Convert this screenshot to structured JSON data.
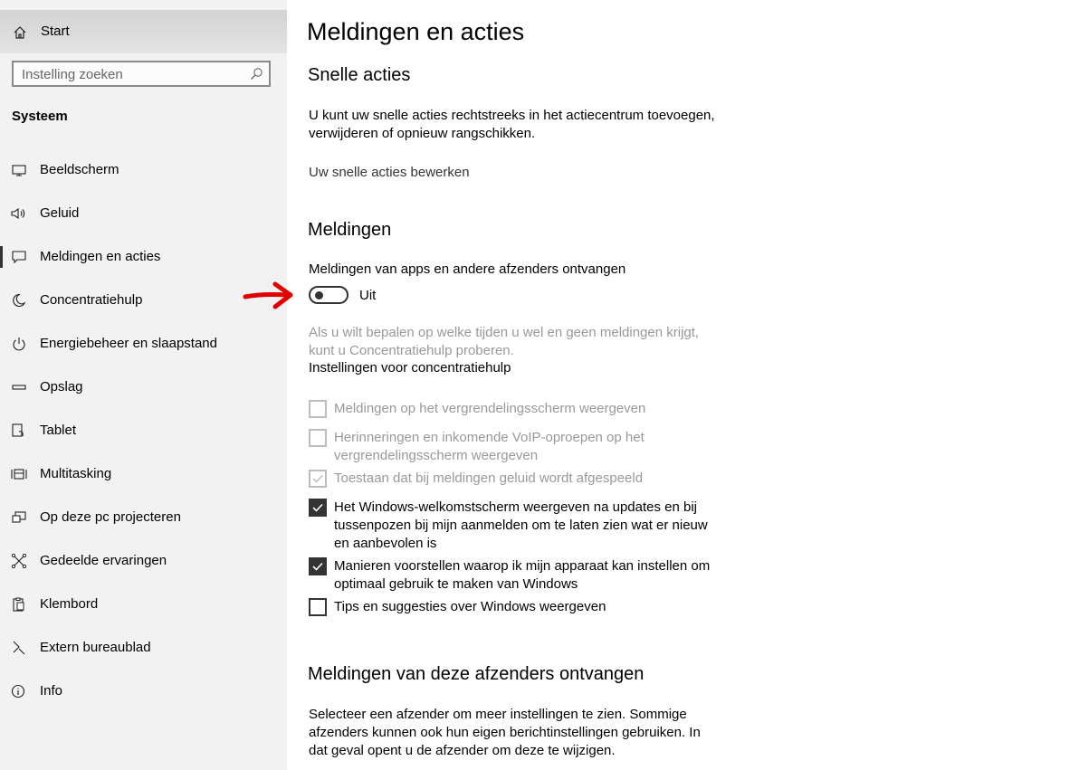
{
  "sidebar": {
    "start_label": "Start",
    "search_placeholder": "Instelling zoeken",
    "section_title": "Systeem",
    "items": [
      {
        "label": "Beeldscherm",
        "icon": "monitor-icon"
      },
      {
        "label": "Geluid",
        "icon": "speaker-icon"
      },
      {
        "label": "Meldingen en acties",
        "icon": "message-icon",
        "active": true
      },
      {
        "label": "Concentratiehulp",
        "icon": "moon-icon"
      },
      {
        "label": "Energiebeheer en slaapstand",
        "icon": "power-icon"
      },
      {
        "label": "Opslag",
        "icon": "storage-icon"
      },
      {
        "label": "Tablet",
        "icon": "tablet-icon"
      },
      {
        "label": "Multitasking",
        "icon": "multitasking-icon"
      },
      {
        "label": "Op deze pc projecteren",
        "icon": "project-icon"
      },
      {
        "label": "Gedeelde ervaringen",
        "icon": "shared-icon"
      },
      {
        "label": "Klembord",
        "icon": "clipboard-icon"
      },
      {
        "label": "Extern bureaublad",
        "icon": "remote-desktop-icon"
      },
      {
        "label": "Info",
        "icon": "info-icon"
      }
    ]
  },
  "main": {
    "title": "Meldingen en acties",
    "quick_actions": {
      "heading": "Snelle acties",
      "description": "U kunt uw snelle acties rechtstreeks in het actiecentrum toevoegen, verwijderen of opnieuw rangschikken.",
      "edit_link": "Uw snelle acties bewerken"
    },
    "notifications": {
      "heading": "Meldingen",
      "toggle_caption": "Meldingen van apps en andere afzenders ontvangen",
      "toggle_state_label": "Uit",
      "toggle_on": false,
      "focus_hint": "Als u wilt bepalen op welke tijden u wel en geen meldingen krijgt, kunt u Concentratiehulp proberen.",
      "focus_link": "Instellingen voor concentratiehulp",
      "checkboxes": [
        {
          "label": "Meldingen op het vergrendelingsscherm weergeven",
          "checked": false,
          "enabled": false
        },
        {
          "label": "Herinneringen en inkomende VoIP-oproepen op het vergrendelingsscherm weergeven",
          "checked": false,
          "enabled": false
        },
        {
          "label": "Toestaan dat bij meldingen geluid wordt afgespeeld",
          "checked": true,
          "enabled": false
        },
        {
          "label": "Het Windows-welkomstscherm weergeven na updates en bij tussenpozen bij mijn aanmelden om te laten zien wat er nieuw en aanbevolen is",
          "checked": true,
          "enabled": true
        },
        {
          "label": "Manieren voorstellen waarop ik mijn apparaat kan instellen om optimaal gebruik te maken van Windows",
          "checked": true,
          "enabled": true
        },
        {
          "label": "Tips en suggesties over Windows weergeven",
          "checked": false,
          "enabled": true
        }
      ]
    },
    "senders": {
      "heading": "Meldingen van deze afzenders ontvangen",
      "description": "Selecteer een afzender om meer instellingen te zien. Sommige afzenders kunnen ook hun eigen berichtinstellingen gebruiken. In dat geval opent u de afzender om deze te wijzigen."
    }
  },
  "colors": {
    "sidebar_bg": "#f2f2f2",
    "annotation_arrow": "#e00000",
    "disabled_text": "#999999"
  }
}
